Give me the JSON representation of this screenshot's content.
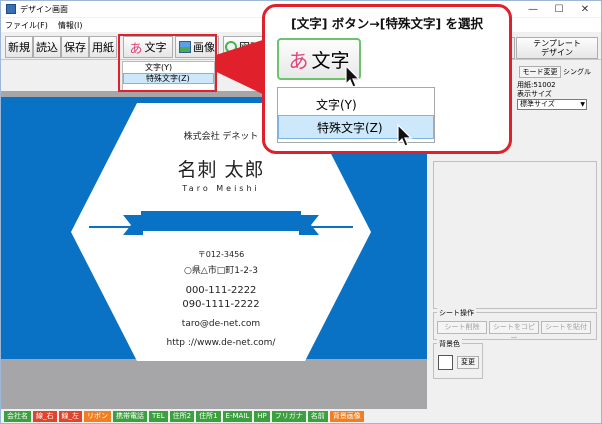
{
  "window": {
    "title": "デザイン画面",
    "controls": {
      "minimize": "—",
      "maximize": "☐",
      "close": "✕"
    }
  },
  "menu": [
    "ファイル(F)",
    "情報(I)"
  ],
  "toolbar": {
    "new": "新規",
    "open": "読込",
    "save": "保存",
    "paper": "用紙",
    "text_icon": "あ",
    "text": "文字",
    "image": "画像",
    "figure": "図形",
    "template_line1": "テンプレート",
    "template_line2": "デザイン"
  },
  "text_dropdown": {
    "items": [
      "文字(Y)",
      "特殊文字(Z)"
    ],
    "selected_index": 1
  },
  "card": {
    "company": "株式会社 デネット",
    "name": "名刺 太郎",
    "roman": "Taro Meishi",
    "zip": "〒012-3456",
    "address": "○県△市□町1-2-3",
    "tel1": "000-111-2222",
    "tel2": "090-1111-2222",
    "email": "taro@de-net.com",
    "url": "http ://www.de-net.com/",
    "colors": {
      "accent": "#0a72c4"
    }
  },
  "right_panel": {
    "mode_button": "モード変更",
    "mode_value": "シングル",
    "paper_label": "用紙:51002",
    "display_size_label": "表示サイズ",
    "display_size_value": "標準サイズ",
    "sheet_group_label": "シート操作",
    "sheet_buttons": [
      "シート削除",
      "シートをコピー",
      "シートを貼付"
    ],
    "bg_group_label": "背景色",
    "bg_change": "変更"
  },
  "field_buttons": [
    {
      "label": "会社名",
      "color": "green"
    },
    {
      "label": "線_右",
      "color": "red"
    },
    {
      "label": "線_左",
      "color": "red"
    },
    {
      "label": "リボン",
      "color": "orange"
    },
    {
      "label": "携帯電話",
      "color": "green"
    },
    {
      "label": "TEL",
      "color": "green"
    },
    {
      "label": "住所2",
      "color": "green"
    },
    {
      "label": "住所1",
      "color": "green"
    },
    {
      "label": "E-MAIL",
      "color": "green"
    },
    {
      "label": "HP",
      "color": "green"
    },
    {
      "label": "フリガナ",
      "color": "green"
    },
    {
      "label": "名前",
      "color": "green"
    },
    {
      "label": "背景画像",
      "color": "orange"
    }
  ],
  "callout": {
    "title": "[文字] ボタン→[特殊文字] を選択",
    "button_icon": "あ",
    "button_text": "文字",
    "items": [
      "文字(Y)",
      "特殊文字(Z)"
    ]
  }
}
